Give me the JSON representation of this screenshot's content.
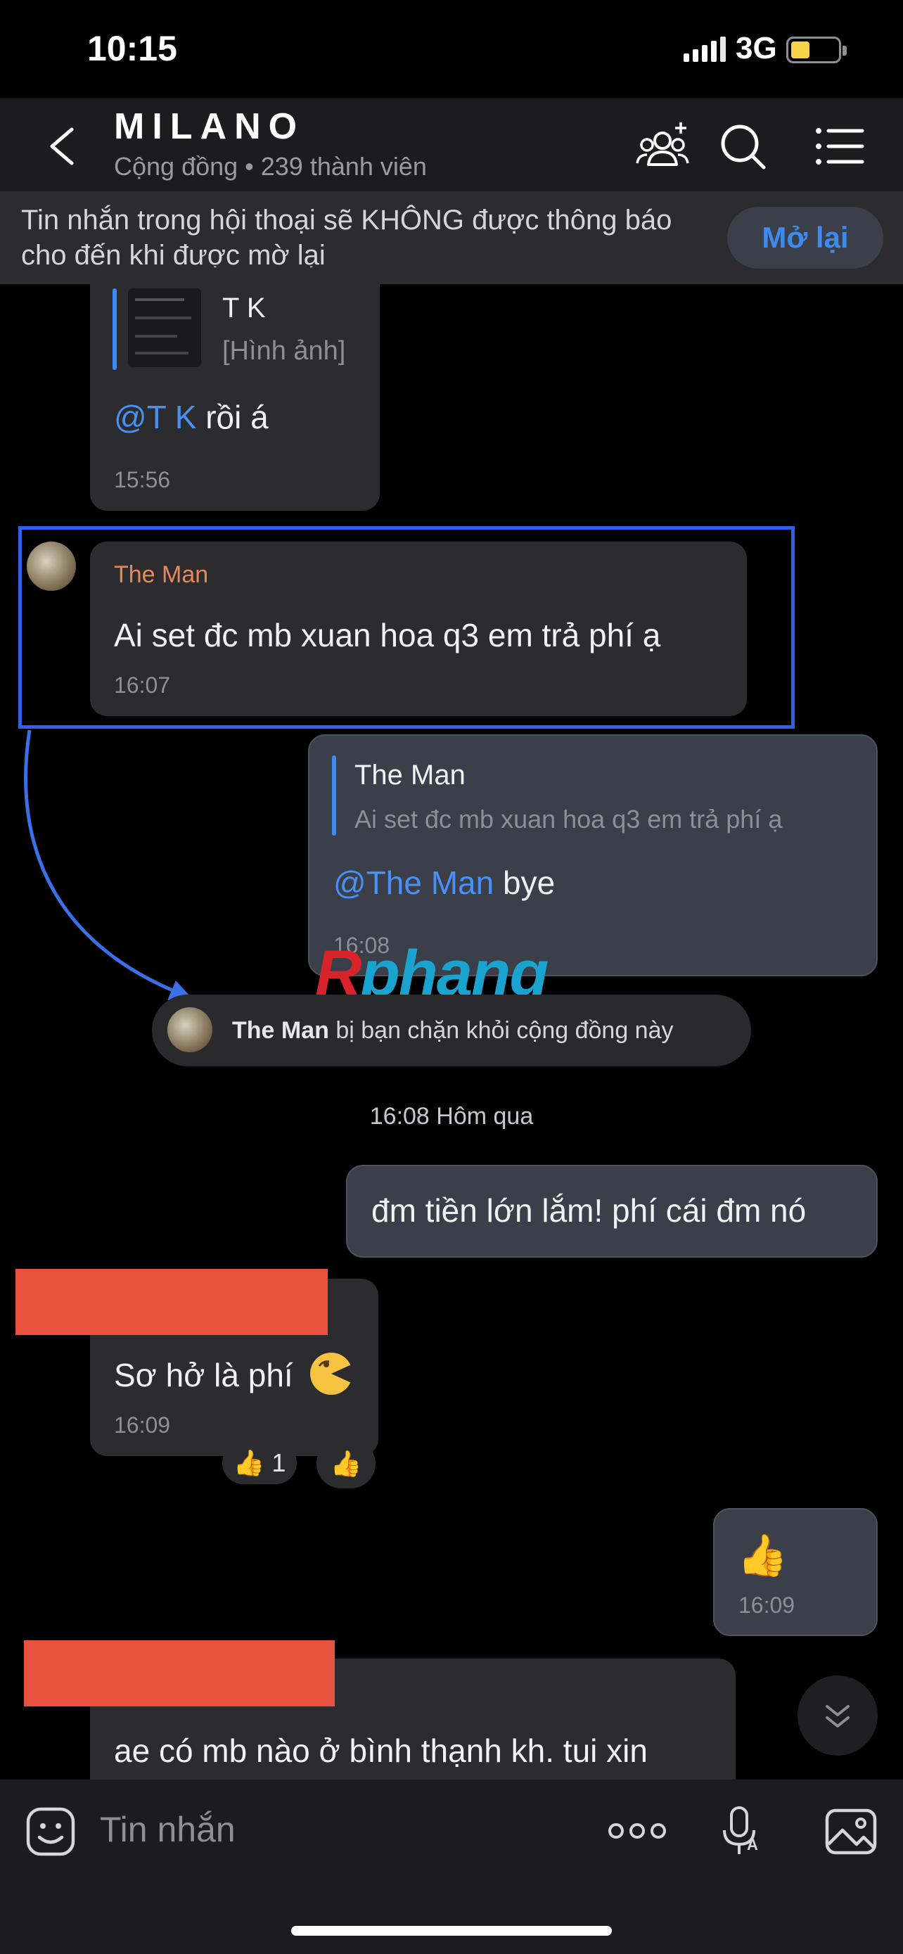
{
  "status_bar": {
    "time": "10:15",
    "network": "3G"
  },
  "header": {
    "title": "MILANO",
    "subtitle": "Cộng đồng • 239 thành viên"
  },
  "banner": {
    "text": "Tin nhắn trong hội thoại sẽ KHÔNG được thông báo cho đến khi được mờ lại",
    "button": "Mở lại"
  },
  "messages": {
    "m1": {
      "quote_name": "T K",
      "quote_text": "[Hình ảnh]",
      "mention": "@T K",
      "text": " rồi á",
      "time": "15:56"
    },
    "m2": {
      "sender": "The Man",
      "text": "Ai set đc mb xuan hoa q3 em trả phí ạ",
      "time": "16:07"
    },
    "m3": {
      "quote_name": "The Man",
      "quote_text": "Ai set đc mb xuan hoa q3 em trả phí ạ",
      "mention": "@The Man",
      "text": " bye",
      "time": "16:08"
    },
    "system": {
      "name": "The Man",
      "text": " bị bạn chặn khỏi cộng đồng này"
    },
    "date_separator": "16:08 Hôm qua",
    "m4": {
      "text": "đm tiền lớn lắm! phí cái đm nó"
    },
    "m5": {
      "text": "Sơ hở là phí",
      "time": "16:09",
      "reaction_count": "1"
    },
    "m6": {
      "emoji": "👍",
      "time": "16:09"
    },
    "m7": {
      "text": "ae có mb nào ở bình thạnh kh. tui xin"
    }
  },
  "watermark": {
    "part1": "R",
    "part2": "phang"
  },
  "input": {
    "placeholder": "Tin nhắn"
  },
  "colors": {
    "accent": "#3d8bf2",
    "highlight": "#2f60e8",
    "sender_name": "#e8875a",
    "redaction": "#e8523e"
  }
}
